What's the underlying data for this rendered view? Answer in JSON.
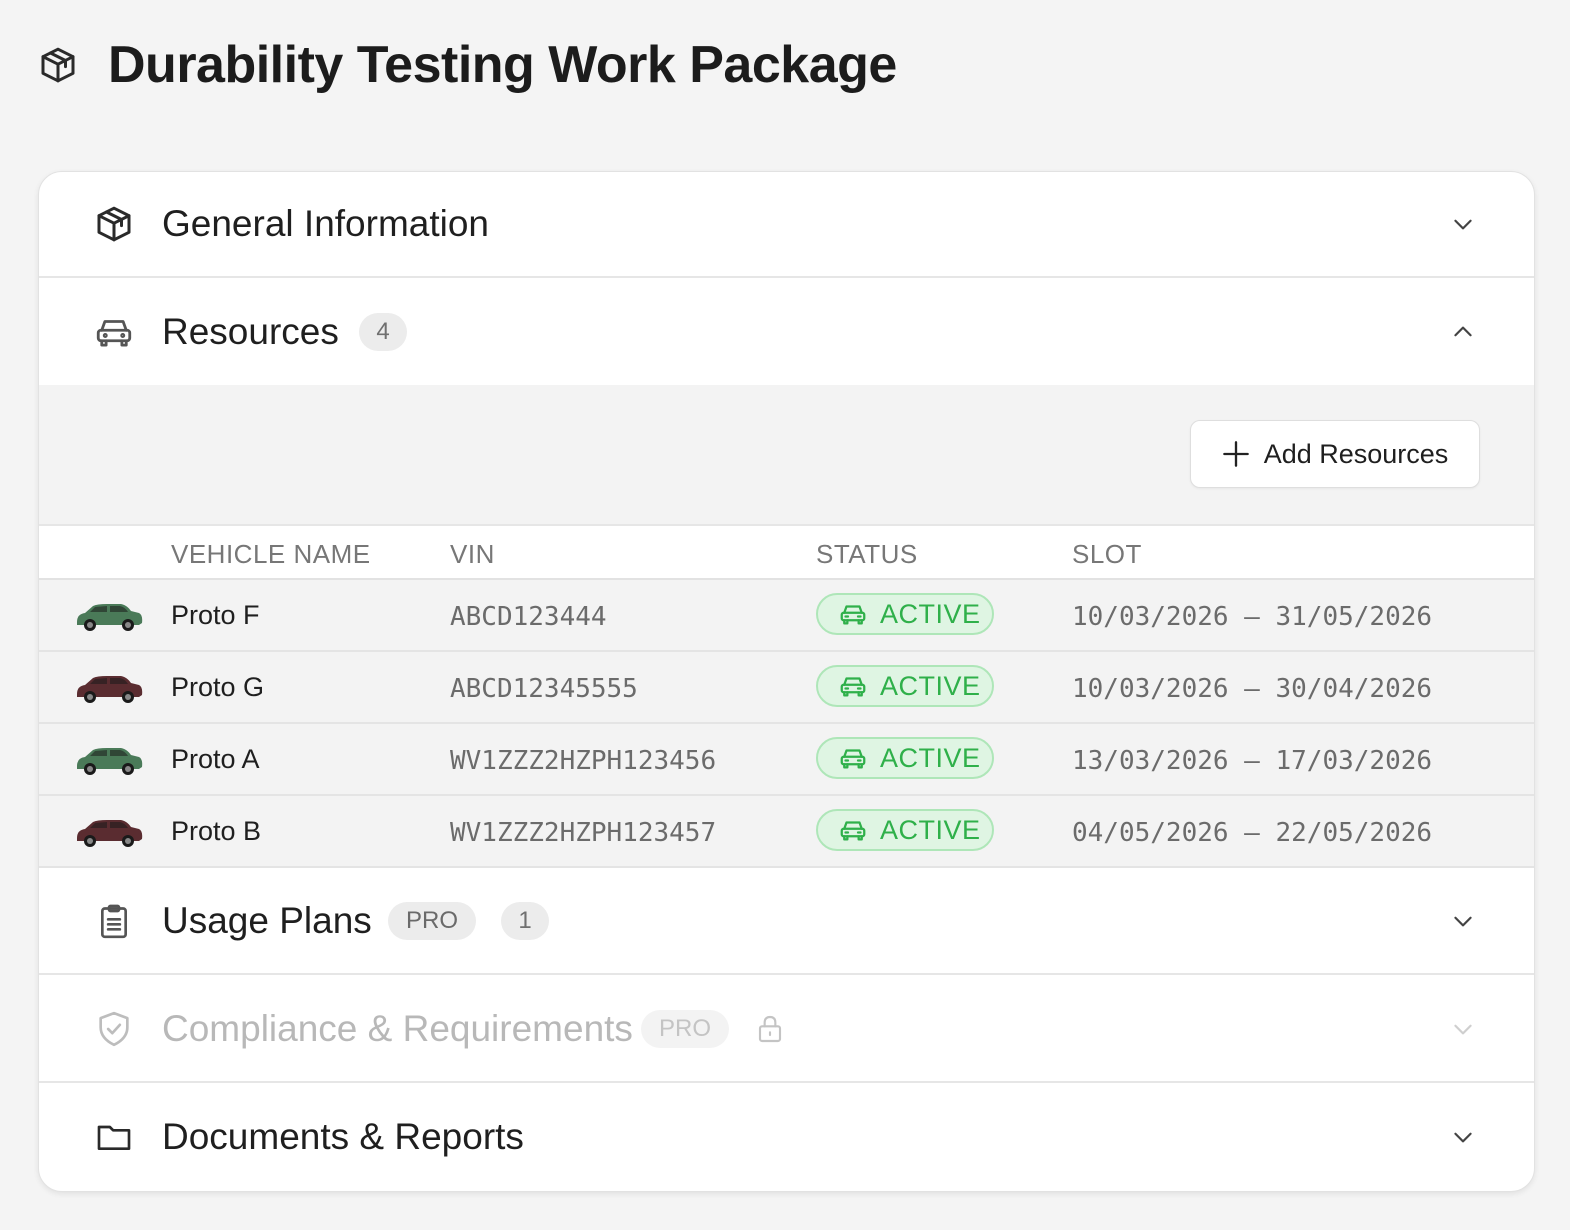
{
  "page": {
    "title": "Durability Testing Work Package",
    "icon": "package-icon"
  },
  "sections": {
    "general": {
      "title": "General Information",
      "icon": "package-icon",
      "expanded": false
    },
    "resources": {
      "title": "Resources",
      "icon": "car-icon",
      "count": "4",
      "expanded": true
    },
    "usage": {
      "title": "Usage Plans",
      "icon": "clipboard-icon",
      "pro": "PRO",
      "count": "1",
      "expanded": false
    },
    "compliance": {
      "title": "Compliance & Requirements",
      "icon": "shield-check-icon",
      "pro": "PRO",
      "locked": true,
      "expanded": false
    },
    "documents": {
      "title": "Documents & Reports",
      "icon": "folder-icon",
      "expanded": false
    }
  },
  "resources": {
    "add_label": "Add Resources",
    "columns": {
      "name": "VEHICLE NAME",
      "vin": "VIN",
      "status": "STATUS",
      "slot": "SLOT"
    },
    "rows": [
      {
        "name": "Proto F",
        "vin": "ABCD123444",
        "status": "ACTIVE",
        "slot": "10/03/2026 – 31/05/2026",
        "car_color": "#4a7a58"
      },
      {
        "name": "Proto G",
        "vin": "ABCD12345555",
        "status": "ACTIVE",
        "slot": "10/03/2026 – 30/04/2026",
        "car_color": "#5a2c30"
      },
      {
        "name": "Proto A",
        "vin": "WV1ZZZ2HZPH123456",
        "status": "ACTIVE",
        "slot": "13/03/2026 – 17/03/2026",
        "car_color": "#4a7a58"
      },
      {
        "name": "Proto B",
        "vin": "WV1ZZZ2HZPH123457",
        "status": "ACTIVE",
        "slot": "04/05/2026 – 22/05/2026",
        "car_color": "#5a2c30"
      }
    ]
  },
  "colors": {
    "active_green": "#2fb04a",
    "active_bg": "#dff5e3",
    "muted_text": "#6b6b6b",
    "page_bg": "#f4f4f4"
  }
}
